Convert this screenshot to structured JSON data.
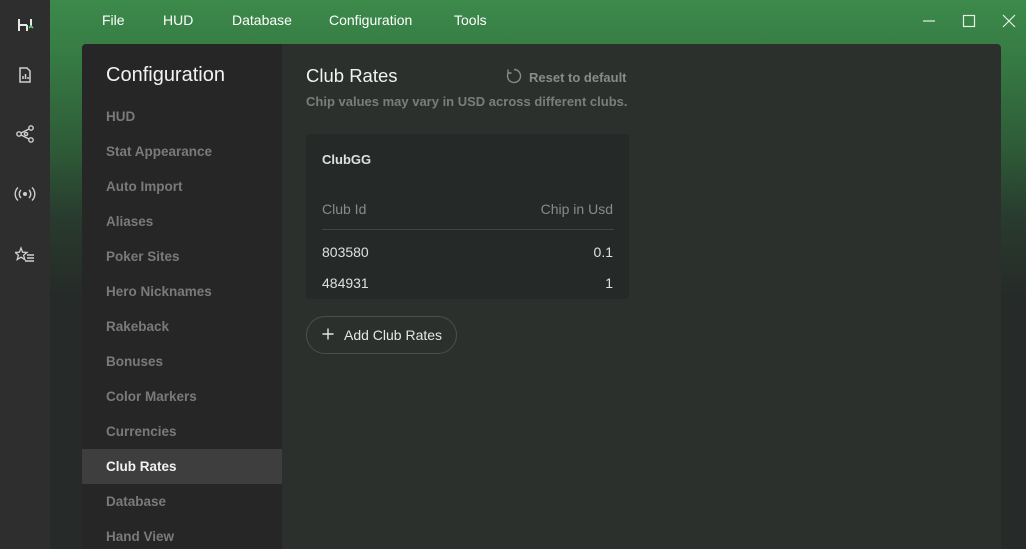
{
  "menubar": {
    "items": [
      "File",
      "HUD",
      "Database",
      "Configuration",
      "Tools"
    ]
  },
  "rail": {
    "icons": [
      "logo-icon",
      "report-icon",
      "share-nodes-icon",
      "broadcast-icon",
      "star-list-icon"
    ]
  },
  "sidebar": {
    "title": "Configuration",
    "items": [
      {
        "label": "HUD"
      },
      {
        "label": "Stat Appearance"
      },
      {
        "label": "Auto Import"
      },
      {
        "label": "Aliases"
      },
      {
        "label": "Poker Sites"
      },
      {
        "label": "Hero Nicknames"
      },
      {
        "label": "Rakeback"
      },
      {
        "label": "Bonuses"
      },
      {
        "label": "Color Markers"
      },
      {
        "label": "Currencies"
      },
      {
        "label": "Club Rates",
        "active": true
      },
      {
        "label": "Database"
      },
      {
        "label": "Hand View"
      }
    ]
  },
  "content": {
    "title": "Club Rates",
    "reset_label": "Reset to default",
    "subtitle": "Chip values may vary in USD across different clubs.",
    "card": {
      "title": "ClubGG",
      "columns": [
        "Club Id",
        "Chip in Usd"
      ],
      "rows": [
        [
          "803580",
          "0.1"
        ],
        [
          "484931",
          "1"
        ]
      ]
    },
    "add_label": "Add Club Rates"
  },
  "colors": {
    "accent_green": "#3c8a4b",
    "background": "#262a28",
    "sidebar_active": "#3e3e3e"
  }
}
